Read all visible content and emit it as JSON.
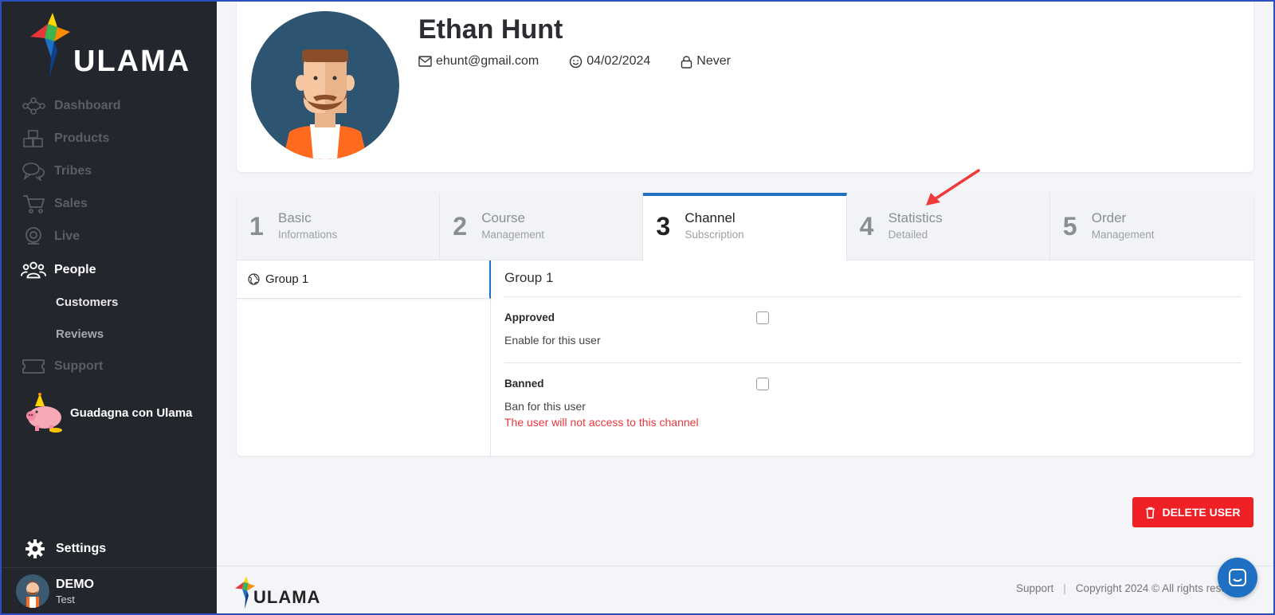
{
  "brand": {
    "name": "ULAMA"
  },
  "sidebar": {
    "items": [
      {
        "label": "Dashboard",
        "icon": "network-icon",
        "active": false
      },
      {
        "label": "Products",
        "icon": "boxes-icon",
        "active": false
      },
      {
        "label": "Tribes",
        "icon": "chat-bubbles-icon",
        "active": false
      },
      {
        "label": "Sales",
        "icon": "cart-icon",
        "active": false
      },
      {
        "label": "Live",
        "icon": "webcam-icon",
        "active": false
      },
      {
        "label": "People",
        "icon": "people-icon",
        "active": true
      }
    ],
    "subitems": [
      {
        "label": "Customers",
        "active": true
      },
      {
        "label": "Reviews",
        "active": false
      }
    ],
    "support": {
      "label": "Support",
      "icon": "ticket-icon"
    },
    "promo": {
      "label": "Guadagna con Ulama",
      "icon": "piggy-bank-icon"
    },
    "settings": {
      "label": "Settings",
      "icon": "gear-icon"
    },
    "user": {
      "name": "DEMO",
      "role": "Test"
    }
  },
  "profile": {
    "name": "Ethan Hunt",
    "email": "ehunt@gmail.com",
    "date": "04/02/2024",
    "last_access": "Never"
  },
  "tabs": [
    {
      "num": "1",
      "title": "Basic",
      "subtitle": "Informations",
      "active": false
    },
    {
      "num": "2",
      "title": "Course",
      "subtitle": "Management",
      "active": false
    },
    {
      "num": "3",
      "title": "Channel",
      "subtitle": "Subscription",
      "active": true
    },
    {
      "num": "4",
      "title": "Statistics",
      "subtitle": "Detailed",
      "active": false
    },
    {
      "num": "5",
      "title": "Order",
      "subtitle": "Management",
      "active": false
    }
  ],
  "groups": {
    "list": [
      {
        "label": "Group 1"
      }
    ],
    "detail": {
      "title": "Group 1",
      "approved": {
        "label": "Approved",
        "desc": "Enable for this user",
        "checked": false
      },
      "banned": {
        "label": "Banned",
        "desc": "Ban for this user",
        "warning": "The user will not access to this channel",
        "checked": false
      }
    }
  },
  "actions": {
    "delete_label": "DELETE USER"
  },
  "footer": {
    "support": "Support",
    "copyright": "Copyright 2024 © All rights reserved"
  },
  "colors": {
    "sidebar_bg": "#24262d",
    "accent": "#1f6fc2",
    "danger": "#f02027",
    "warning_text": "#e8363b",
    "annotation": "#ee3a3a"
  }
}
